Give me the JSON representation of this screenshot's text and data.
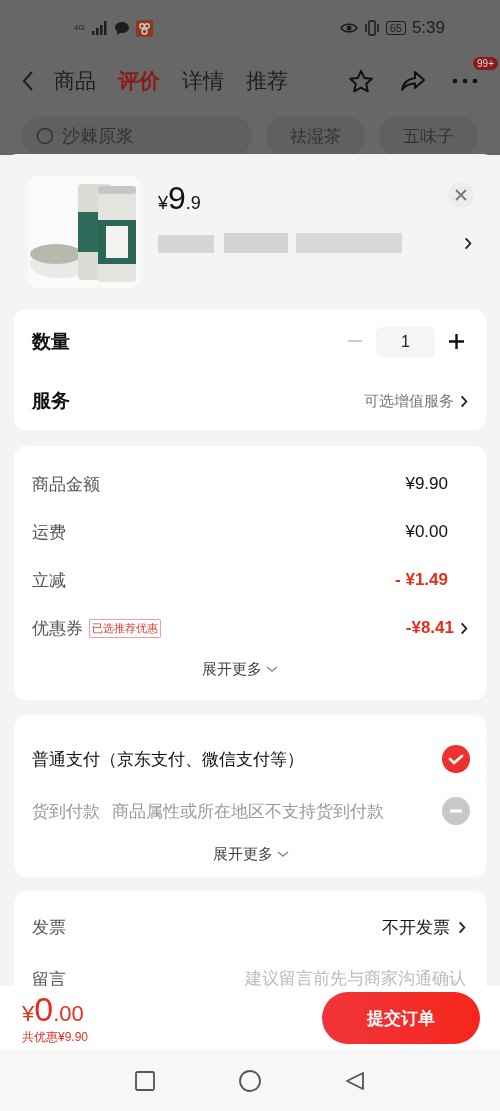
{
  "status_bar": {
    "network": "4G",
    "battery": "65",
    "time": "5:39"
  },
  "nav": {
    "tabs": [
      {
        "label": "商品",
        "selected": false
      },
      {
        "label": "评价",
        "selected": true
      },
      {
        "label": "详情",
        "selected": false
      },
      {
        "label": "推荐",
        "selected": false
      }
    ],
    "badge": "99+"
  },
  "search": {
    "placeholder": "沙棘原浆",
    "chips": [
      "祛湿茶",
      "五味子"
    ]
  },
  "product": {
    "price_symbol": "¥",
    "price_int": "9",
    "price_dec": ".9"
  },
  "quantity": {
    "label": "数量",
    "value": "1",
    "decrement_disabled": true
  },
  "service": {
    "label": "服务",
    "value": "可选增值服务"
  },
  "fees": {
    "rows": [
      {
        "label": "商品金额",
        "value": "¥9.90",
        "kind": "plain"
      },
      {
        "label": "运费",
        "value": "¥0.00",
        "kind": "plain"
      },
      {
        "label": "立减",
        "value": "- ¥1.49",
        "kind": "discount"
      },
      {
        "label": "优惠券",
        "tag": "已选推荐优惠",
        "value": "-¥8.41",
        "kind": "discount-link"
      }
    ],
    "expand": "展开更多"
  },
  "payment": {
    "options": [
      {
        "label": "普通支付（京东支付、微信支付等）",
        "selected": true,
        "disabled": false
      },
      {
        "label": "货到付款",
        "note": "商品属性或所在地区不支持货到付款",
        "selected": false,
        "disabled": true
      }
    ],
    "expand": "展开更多"
  },
  "extras": [
    {
      "kind": "link",
      "label": "发票",
      "value": "不开发票"
    },
    {
      "kind": "input",
      "label": "留言",
      "placeholder": "建议留言前先与商家沟通确认"
    }
  ],
  "footer": {
    "symbol": "¥",
    "total_int": "0",
    "total_dec": ".00",
    "savings": "共优惠¥9.90",
    "submit": "提交订单"
  }
}
